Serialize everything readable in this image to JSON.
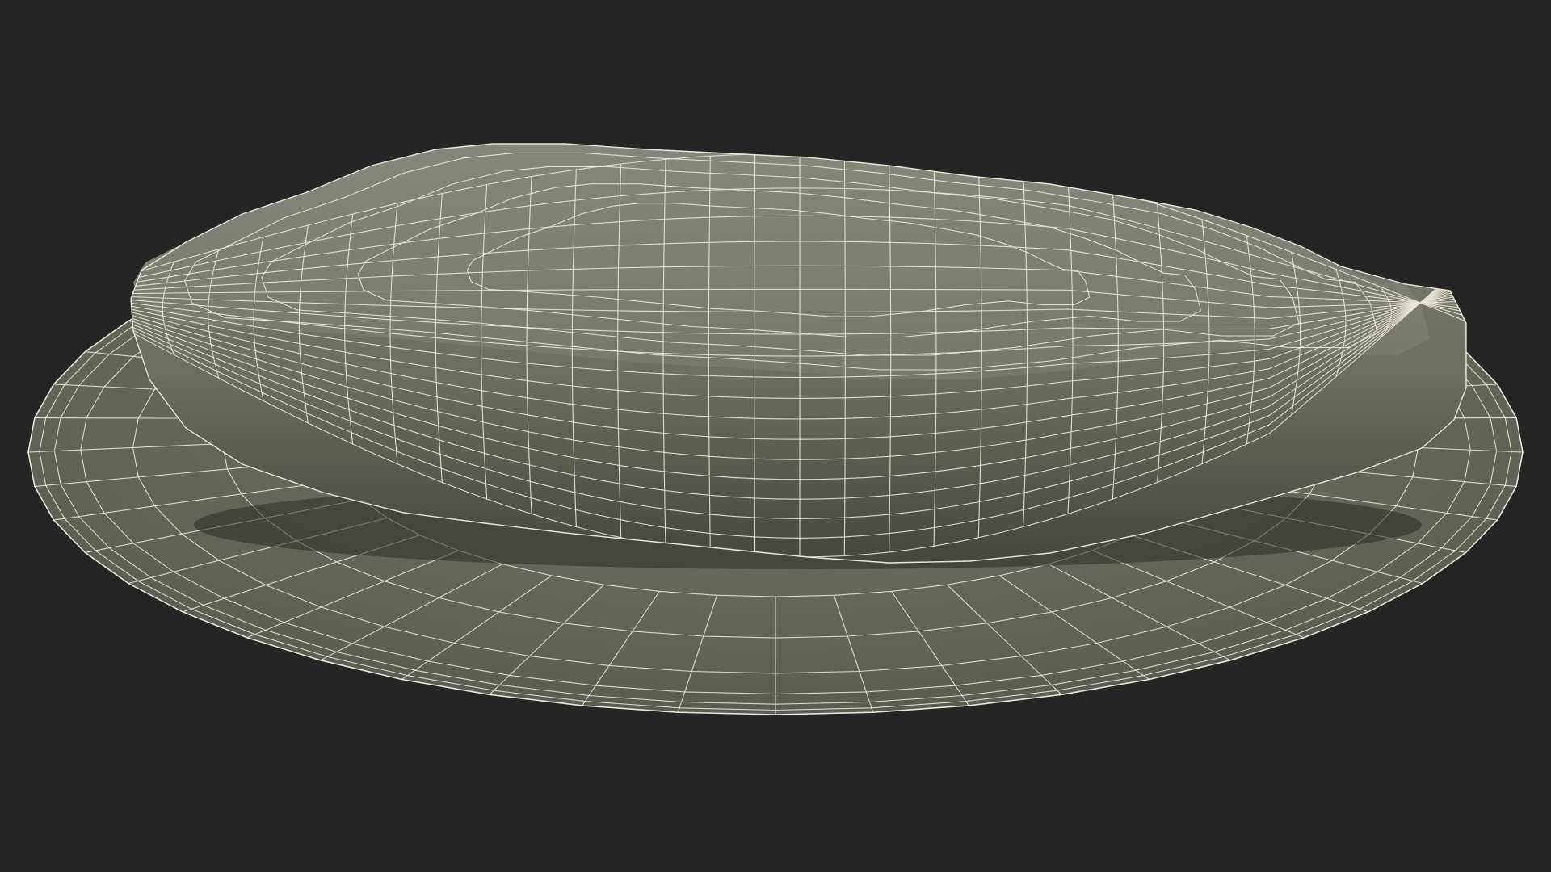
{
  "scene": {
    "background_color": "#252525",
    "object": "wireframe-render-of-oval-cushion-on-plate",
    "surface_color": "#74766a",
    "wire_color": "#e8e6d6",
    "shade_color": "#3e3f38"
  }
}
